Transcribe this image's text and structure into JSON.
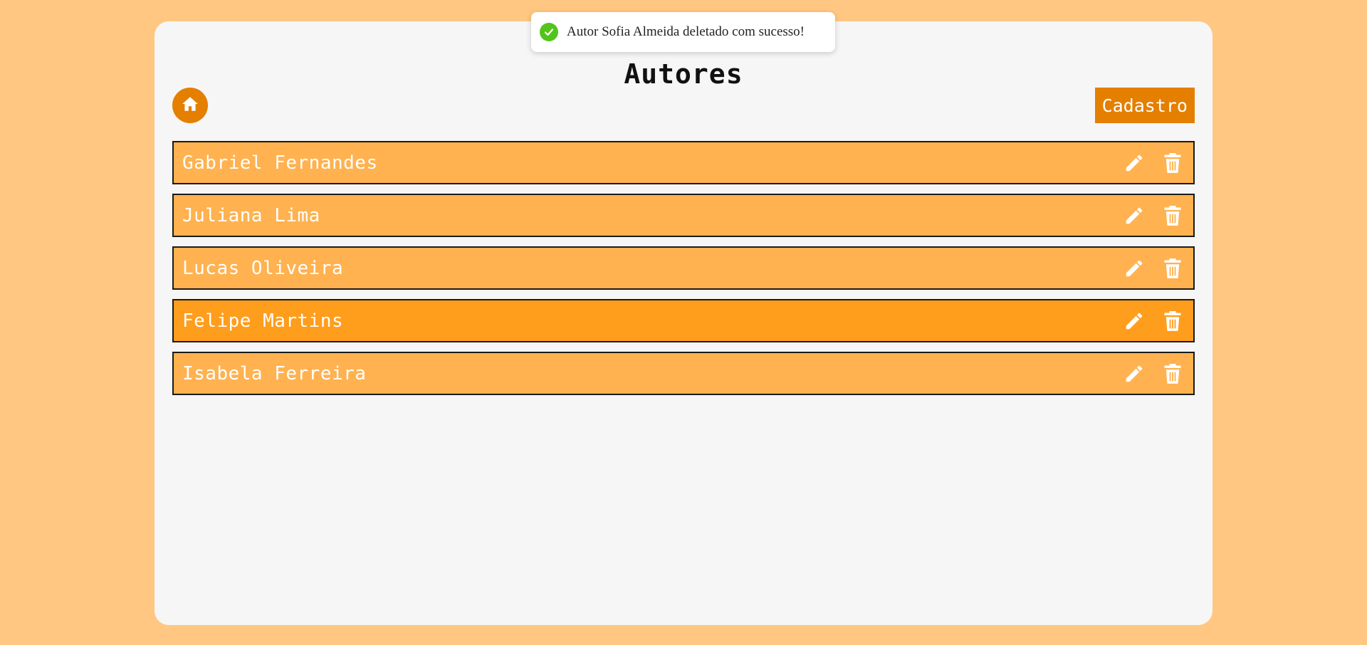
{
  "page": {
    "title": "Autores"
  },
  "toolbar": {
    "home_icon": "home-icon",
    "cadastro_label": "Cadastro"
  },
  "toast": {
    "message": "Autor Sofia Almeida deletado com sucesso!",
    "icon": "check-circle-icon"
  },
  "authors": [
    {
      "name": "Gabriel Fernandes"
    },
    {
      "name": "Juliana Lima"
    },
    {
      "name": "Lucas Oliveira"
    },
    {
      "name": "Felipe Martins"
    },
    {
      "name": "Isabela Ferreira"
    }
  ],
  "row_actions": {
    "edit_icon": "pencil-icon",
    "delete_icon": "trash-icon"
  },
  "colors": {
    "background": "#ffc781",
    "card": "#f6f6f6",
    "accent": "#e47f00",
    "row": "#ffb24f",
    "row_hover": "#ff9d1c",
    "success": "#52c41a"
  }
}
